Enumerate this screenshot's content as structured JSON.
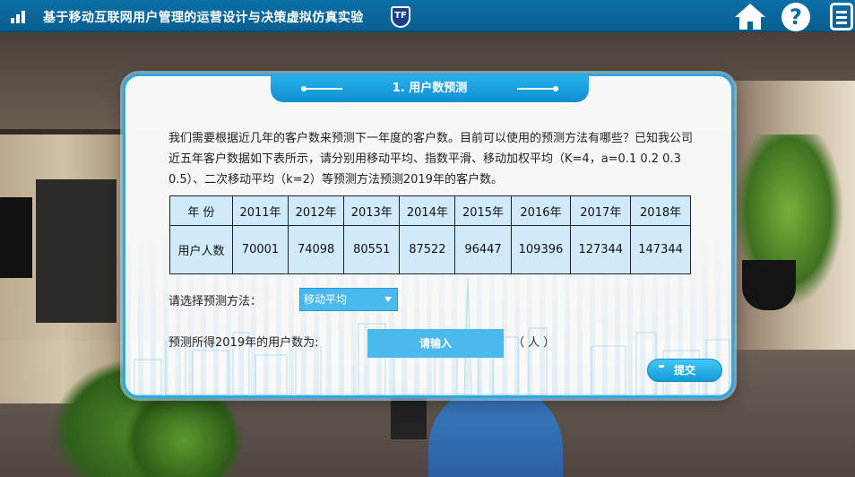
{
  "header": {
    "title": "基于移动互联网用户管理的运营设计与决策虚拟仿真实验",
    "logo_text": "TF",
    "help_glyph": "?"
  },
  "dialog": {
    "tab_title": "1. 用户数预测",
    "description": "我们需要根据近几年的客户数来预测下一年度的客户数。目前可以使用的预测方法有哪些？已知我公司近五年客户数据如下表所示，请分别用移动平均、指数平滑、移动加权平均（K=4，a=0.1 0.2  0.3 0.5）、二次移动平均（k=2）等预测方法预测2019年的客户数。",
    "table": {
      "header_label": "年 份",
      "years": [
        "2011年",
        "2012年",
        "2013年",
        "2014年",
        "2015年",
        "2016年",
        "2017年",
        "2018年"
      ],
      "row_label": "用户人数",
      "values": [
        "70001",
        "74098",
        "80551",
        "87522",
        "96447",
        "109396",
        "127344",
        "147344"
      ]
    },
    "method_label": "请选择预测方法：",
    "method_selected": "移动平均",
    "result_label": "预测所得2019年的用户数为:",
    "result_placeholder": "请输入",
    "unit": "（ 人 ）",
    "submit_label": "提交"
  },
  "colors": {
    "topbar": "#0b6fa6",
    "accent": "#4cb9ee",
    "table_bg": "#d0e9fb",
    "tab": "#0e8fcf"
  },
  "icons": [
    "signal-icon",
    "school-logo",
    "home-icon",
    "help-icon",
    "menu-icon"
  ]
}
